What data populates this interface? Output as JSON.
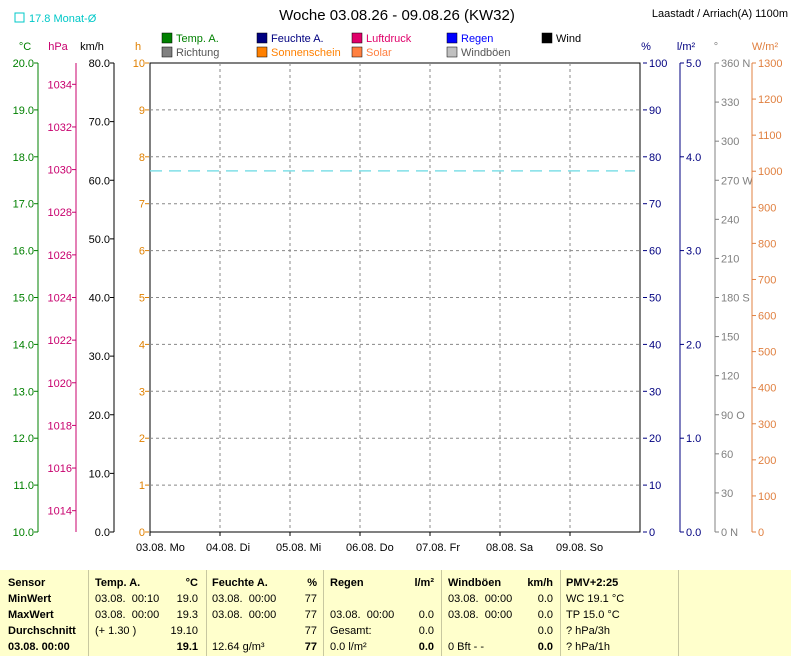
{
  "chart_data": {
    "type": "line",
    "title": "Woche 03.08.26 - 09.08.26 (KW32)",
    "station": "Laastadt / Arriach(A) 1100m",
    "monthly_avg_label": "17.8 Monat-Ø",
    "x_categories": [
      "03.08.  Mo",
      "04.08.  Di",
      "05.08.  Mi",
      "06.08.  Do",
      "07.08.  Fr",
      "08.08.  Sa",
      "09.08.  So"
    ],
    "legend": [
      {
        "label": "Temp. A.",
        "color": "#008000"
      },
      {
        "label": "Feuchte A.",
        "color": "#000080"
      },
      {
        "label": "Luftdruck",
        "color": "#e0006a"
      },
      {
        "label": "Regen",
        "color": "#0000ff"
      },
      {
        "label": "Wind",
        "color": "#000000"
      },
      {
        "label": "Richtung",
        "color": "#808080"
      },
      {
        "label": "Sonnenschein",
        "color": "#ff8000"
      },
      {
        "label": "Solar",
        "color": "#ff8040"
      },
      {
        "label": "Windböen",
        "color": "#c0c0c0"
      }
    ],
    "axes": [
      {
        "unit": "°C",
        "color": "#008000",
        "ticks": [
          "20.0",
          "19.0",
          "18.0",
          "17.0",
          "16.0",
          "15.0",
          "14.0",
          "13.0",
          "12.0",
          "11.0",
          "10.0"
        ]
      },
      {
        "unit": "hPa",
        "color": "#c8006e",
        "ticks": [
          "1034",
          "1032",
          "1030",
          "1028",
          "1026",
          "1024",
          "1022",
          "1020",
          "1018",
          "1016",
          "1014"
        ]
      },
      {
        "unit": "km/h",
        "color": "#000000",
        "ticks": [
          "80.0",
          "70.0",
          "60.0",
          "50.0",
          "40.0",
          "30.0",
          "20.0",
          "10.0",
          "0.0"
        ]
      },
      {
        "unit": "h",
        "color": "#e08000",
        "ticks": [
          "10",
          "9",
          "8",
          "7",
          "6",
          "5",
          "4",
          "3",
          "2",
          "1",
          "0"
        ]
      },
      {
        "unit": "%",
        "color": "#000080",
        "ticks": [
          "100",
          "90",
          "80",
          "70",
          "60",
          "50",
          "40",
          "30",
          "20",
          "10",
          "0"
        ]
      },
      {
        "unit": "l/m²",
        "color": "#000080",
        "ticks": [
          "5.0",
          "4.0",
          "3.0",
          "2.0",
          "1.0",
          "0.0"
        ]
      },
      {
        "unit": "°",
        "color": "#808080",
        "ticks": [
          "360 N",
          "330",
          "300",
          "270 W",
          "240",
          "210",
          "180 S",
          "150",
          "120",
          "90  O",
          "60",
          "30",
          "0  N"
        ]
      },
      {
        "unit": "W/m²",
        "color": "#e08040",
        "ticks": [
          "1300",
          "1200",
          "1100",
          "1000",
          "900",
          "800",
          "700",
          "600",
          "500",
          "400",
          "300",
          "200",
          "100",
          "0"
        ]
      }
    ],
    "series": [
      {
        "name": "Feuchte A.",
        "axis": "%",
        "color": "#80dfe8",
        "style": "dashed",
        "x_start": "03.08.",
        "x_end": "09.08.",
        "y_start": 77,
        "y_end": 77
      }
    ]
  },
  "stats": {
    "headers": {
      "sensor": "Sensor",
      "temp": "Temp. A.",
      "temp_unit": "°C",
      "hum": "Feuchte A.",
      "hum_unit": "%",
      "rain": "Regen",
      "rain_unit": "l/m²",
      "gust": "Windböen",
      "gust_unit": "km/h",
      "pmv": "PMV+2:25"
    },
    "rows": [
      {
        "label": "MinWert",
        "temp_time": "03.08.  00:10",
        "temp_val": "19.0",
        "hum_time": "03.08.  00:00",
        "hum_val": "77",
        "rain_time": "",
        "rain_val": "",
        "gust_time": "03.08.  00:00",
        "gust_val": "0.0",
        "extra": "WC 19.1 °C"
      },
      {
        "label": "MaxWert",
        "temp_time": "03.08.  00:00",
        "temp_val": "19.3",
        "hum_time": "03.08.  00:00",
        "hum_val": "77",
        "rain_time": "03.08.  00:00",
        "rain_val": "0.0",
        "gust_time": "03.08.  00:00",
        "gust_val": "0.0",
        "extra": "TP 15.0 °C"
      },
      {
        "label": "Durchschnitt",
        "temp_time": "(+ 1.30 )",
        "temp_val": "19.10",
        "hum_time": "",
        "hum_val": "77",
        "rain_time": "Gesamt:",
        "rain_val": "0.0",
        "gust_time": "",
        "gust_val": "0.0",
        "extra": "? hPa/3h"
      },
      {
        "label": "03.08.  00:00",
        "temp_time": "",
        "temp_val": "19.1",
        "hum_time": "12.64 g/m³",
        "hum_val": "77",
        "rain_time": "0.0 l/m²",
        "rain_val": "0.0",
        "gust_time": "0 Bft - -",
        "gust_val": "0.0",
        "extra": "? hPa/1h"
      }
    ]
  }
}
